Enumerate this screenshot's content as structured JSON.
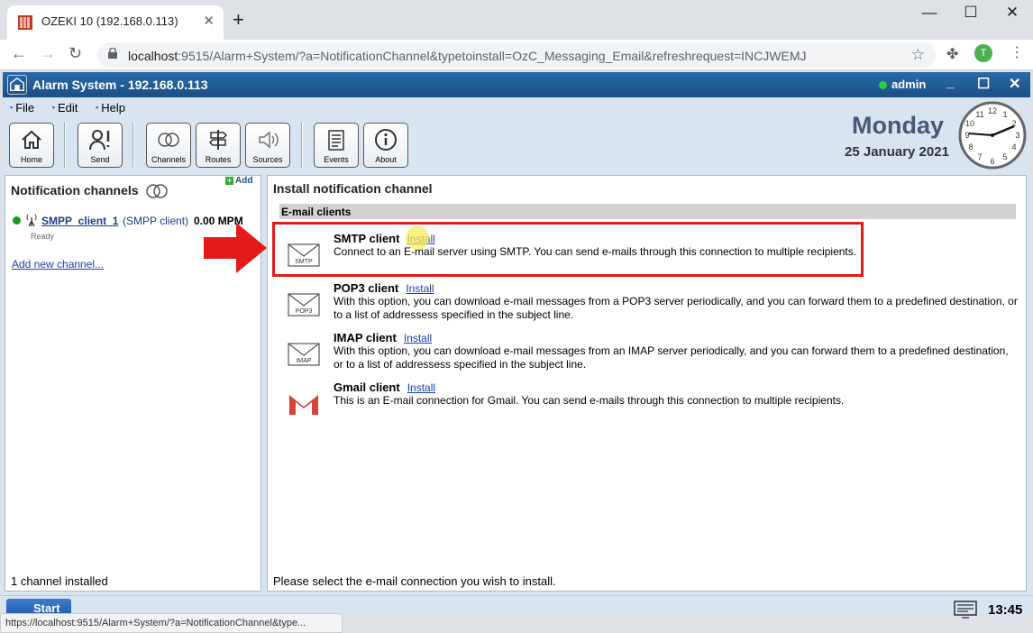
{
  "browser": {
    "tab_title": "OZEKI 10 (192.168.0.113)",
    "url_host": "localhost",
    "url_rest": ":9515/Alarm+System/?a=NotificationChannel&typetoinstall=OzC_Messaging_Email&refreshrequest=INCJWEMJ",
    "profile_initial": "T",
    "status_url": "https://localhost:9515/Alarm+System/?a=NotificationChannel&type..."
  },
  "app": {
    "title": "Alarm System - 192.168.0.113",
    "user": "admin",
    "menu": [
      "File",
      "Edit",
      "Help"
    ],
    "toolbar": [
      {
        "label": "Home",
        "icon": "home-icon"
      },
      {
        "label": "Send",
        "icon": "send-icon"
      },
      {
        "label": "Channels",
        "icon": "channels-icon"
      },
      {
        "label": "Routes",
        "icon": "routes-icon"
      },
      {
        "label": "Sources",
        "icon": "sources-icon"
      },
      {
        "label": "Events",
        "icon": "events-icon"
      },
      {
        "label": "About",
        "icon": "about-icon"
      }
    ],
    "day": "Monday",
    "date": "25 January 2021"
  },
  "left_panel": {
    "title": "Notification channels",
    "add_label": "Add",
    "channel": {
      "name": "SMPP_client_1",
      "type": "(SMPP client)",
      "rate": "0.00 MPM",
      "status": "Ready"
    },
    "add_new": "Add new channel...",
    "footer": "1 channel installed"
  },
  "right_panel": {
    "title": "Install notification channel",
    "section": "E-mail clients",
    "install_label": "Install",
    "items": [
      {
        "name": "SMTP client",
        "icon": "smtp-icon",
        "icon_text": "SMTP",
        "desc": "Connect to an E-mail server using SMTP. You can send e-mails through this connection to multiple recipients."
      },
      {
        "name": "POP3 client",
        "icon": "pop3-icon",
        "icon_text": "POP3",
        "desc": "With this option, you can download e-mail messages from a POP3 server periodically, and you can forward them to a predefined destination, or to a list of addressess specified in the subject line."
      },
      {
        "name": "IMAP client",
        "icon": "imap-icon",
        "icon_text": "IMAP",
        "desc": "With this option, you can download e-mail messages from an IMAP server periodically, and you can forward them to a predefined destination, or to a list of addressess specified in the subject line."
      },
      {
        "name": "Gmail client",
        "icon": "gmail-icon",
        "icon_text": "",
        "desc": "This is an E-mail connection for Gmail. You can send e-mails through this connection to multiple recipients."
      }
    ],
    "footer": "Please select the e-mail connection you wish to install."
  },
  "taskbar": {
    "start": "Start",
    "time": "13:45"
  },
  "colors": {
    "header": "#1b4f86",
    "highlight": "#e41a1a",
    "link": "#1a3fb0"
  }
}
